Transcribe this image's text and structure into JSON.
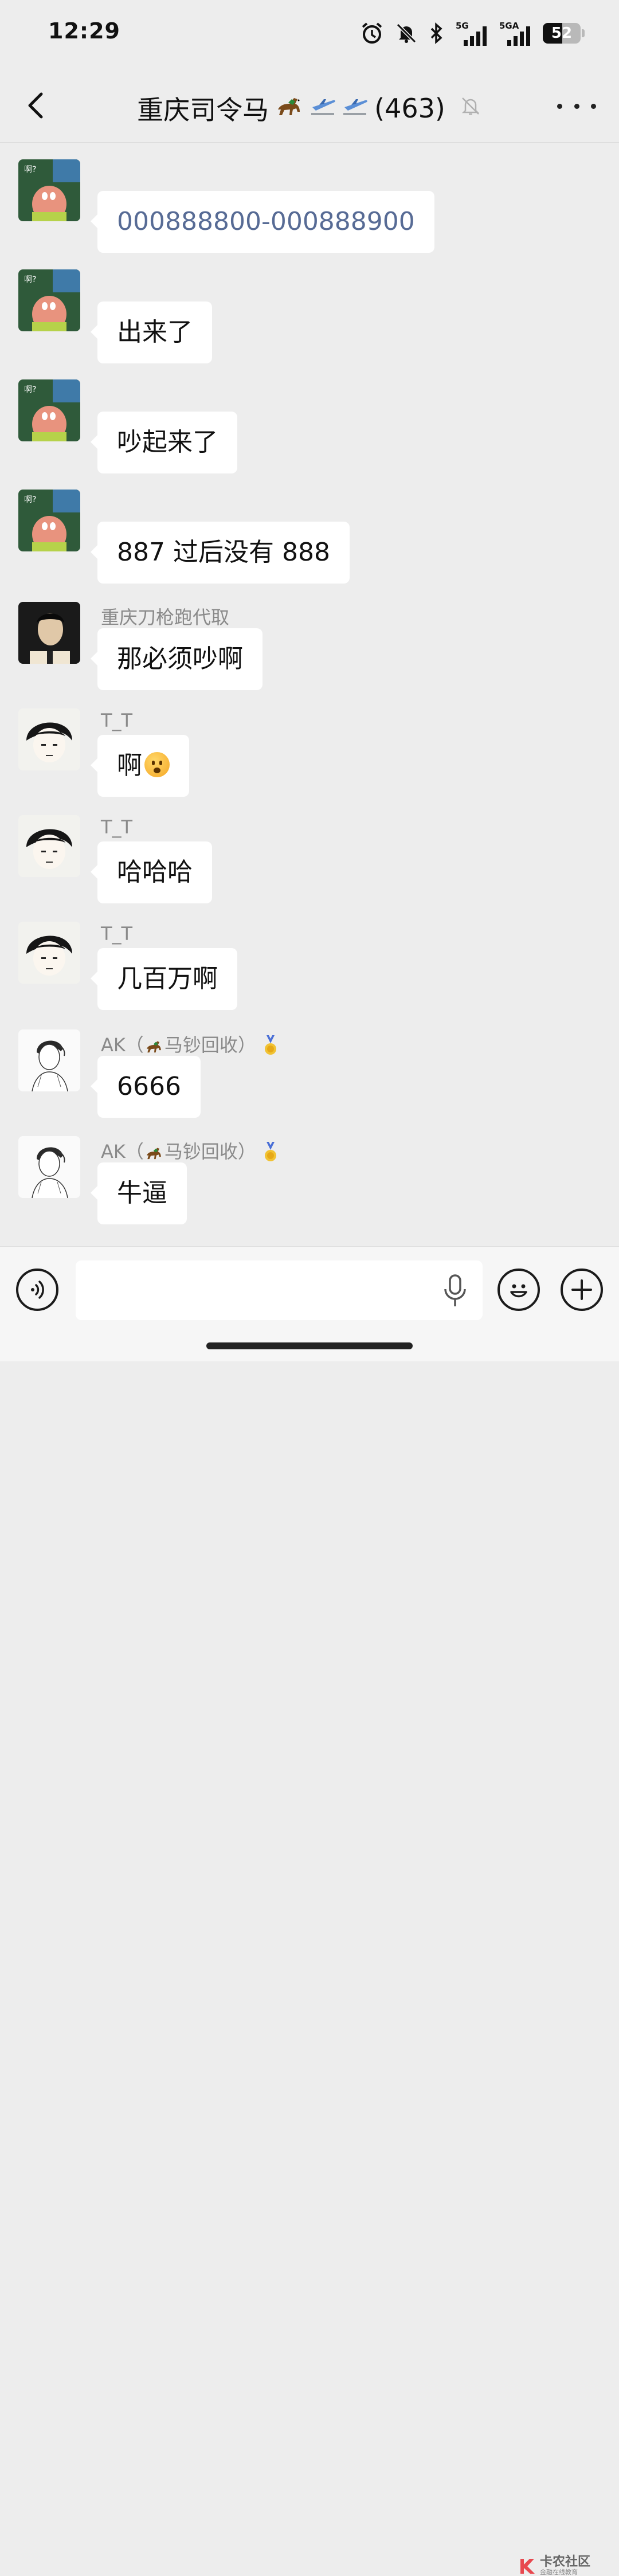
{
  "status_bar": {
    "time": "12:29",
    "net1": "5G",
    "net2": "5GA",
    "battery": "52",
    "battery_level": 52
  },
  "header": {
    "title_main": "重庆司令马",
    "title_count": "(463)"
  },
  "messages": [
    {
      "sender": "",
      "text": "000888800-000888900",
      "avatar": "patrick"
    },
    {
      "sender": "",
      "text": "出来了",
      "avatar": "patrick"
    },
    {
      "sender": "",
      "text": "吵起来了",
      "avatar": "patrick"
    },
    {
      "sender": "",
      "text": "887 过后没有 888",
      "avatar": "patrick"
    },
    {
      "sender": "重庆刀枪跑代取",
      "text": "那必须吵啊",
      "avatar": "man-photo"
    },
    {
      "sender": "T_T",
      "text": "啊",
      "avatar": "anime-boy"
    },
    {
      "sender": "T_T",
      "text": "哈哈哈",
      "avatar": "anime-boy"
    },
    {
      "sender": "T_T",
      "text": "几百万啊",
      "avatar": "anime-boy"
    },
    {
      "sender_prefix": "AK（",
      "sender_suffix": "马钞回收）",
      "text": "6666",
      "avatar": "sketch-man"
    },
    {
      "sender_prefix": "AK（",
      "sender_suffix": "马钞回收）",
      "text": "牛逼",
      "avatar": "sketch-man"
    }
  ],
  "watermark": {
    "title": "卡农社区",
    "subtitle": "金融在线教育"
  },
  "icons": [
    "back-arrow-icon",
    "mute-bell-icon",
    "more-icon",
    "voice-icon",
    "mic-icon",
    "emoji-icon",
    "plus-icon"
  ],
  "colors": {
    "bg": "#ededed",
    "link": "#576b95",
    "bubble": "#ffffff"
  }
}
